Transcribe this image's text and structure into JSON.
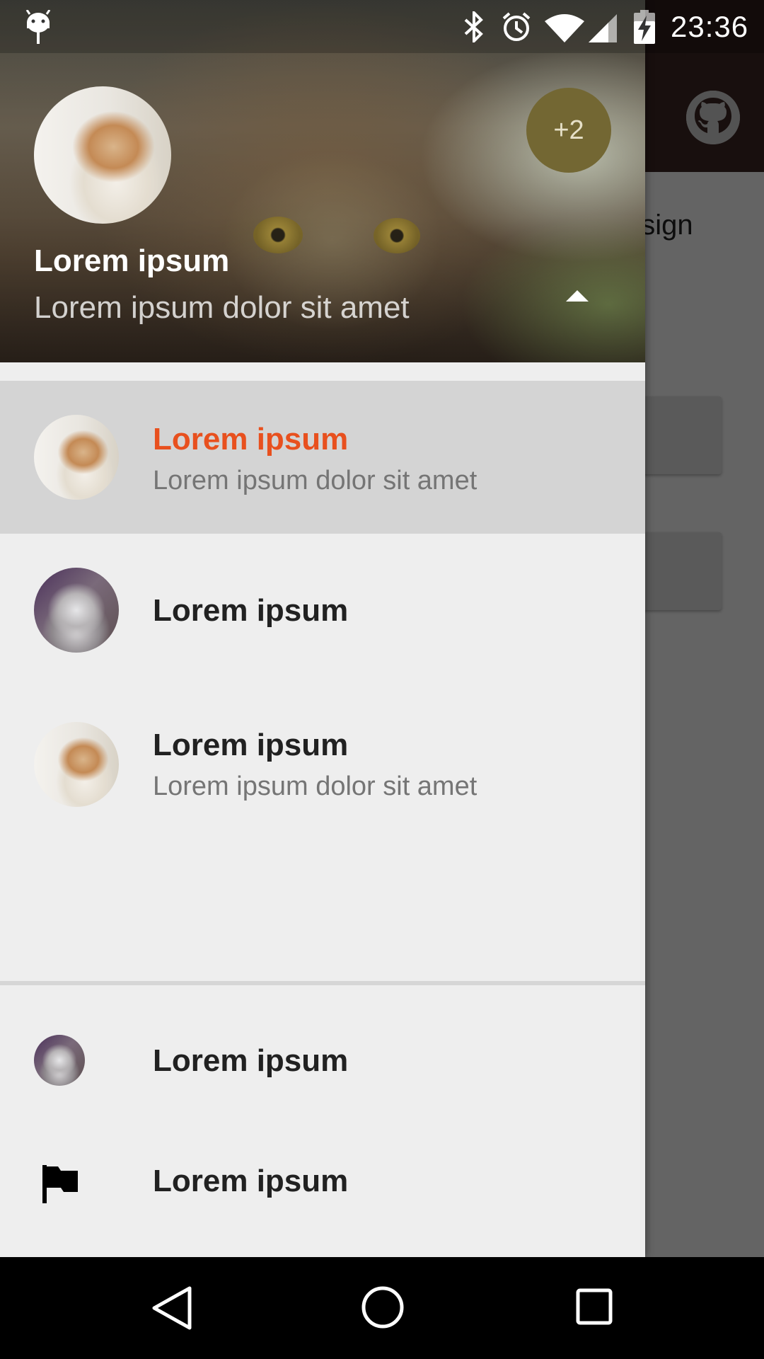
{
  "status_bar": {
    "time": "23:36",
    "icons": [
      "android-icon",
      "bluetooth-icon",
      "alarm-icon",
      "wifi-icon",
      "signal-icon",
      "battery-charging-icon"
    ]
  },
  "background": {
    "visible_text": "esign",
    "toolbar_color": "#3e2723",
    "toolbar_icon": "github-icon"
  },
  "drawer": {
    "header": {
      "name": "Lorem ipsum",
      "email": "Lorem ipsum dolor sit amet",
      "badge": "+2",
      "badge_color": "#736733",
      "toggle_icon": "arrow-up-icon"
    },
    "profiles": [
      {
        "title": "Lorem ipsum",
        "subtitle": "Lorem ipsum dolor sit amet",
        "selected": true,
        "avatar": "ginger-cat"
      },
      {
        "title": "Lorem ipsum",
        "subtitle": "",
        "selected": false,
        "avatar": "grey-cat"
      },
      {
        "title": "Lorem ipsum",
        "subtitle": "Lorem ipsum dolor sit amet",
        "selected": false,
        "avatar": "ginger-cat"
      }
    ],
    "footer": [
      {
        "title": "Lorem ipsum",
        "icon": "grey-cat-avatar"
      },
      {
        "title": "Lorem ipsum",
        "icon": "flag-icon"
      }
    ],
    "accent_color": "#e8501e"
  },
  "nav_bar": {
    "icons": [
      "back-icon",
      "home-icon",
      "recents-icon"
    ]
  }
}
